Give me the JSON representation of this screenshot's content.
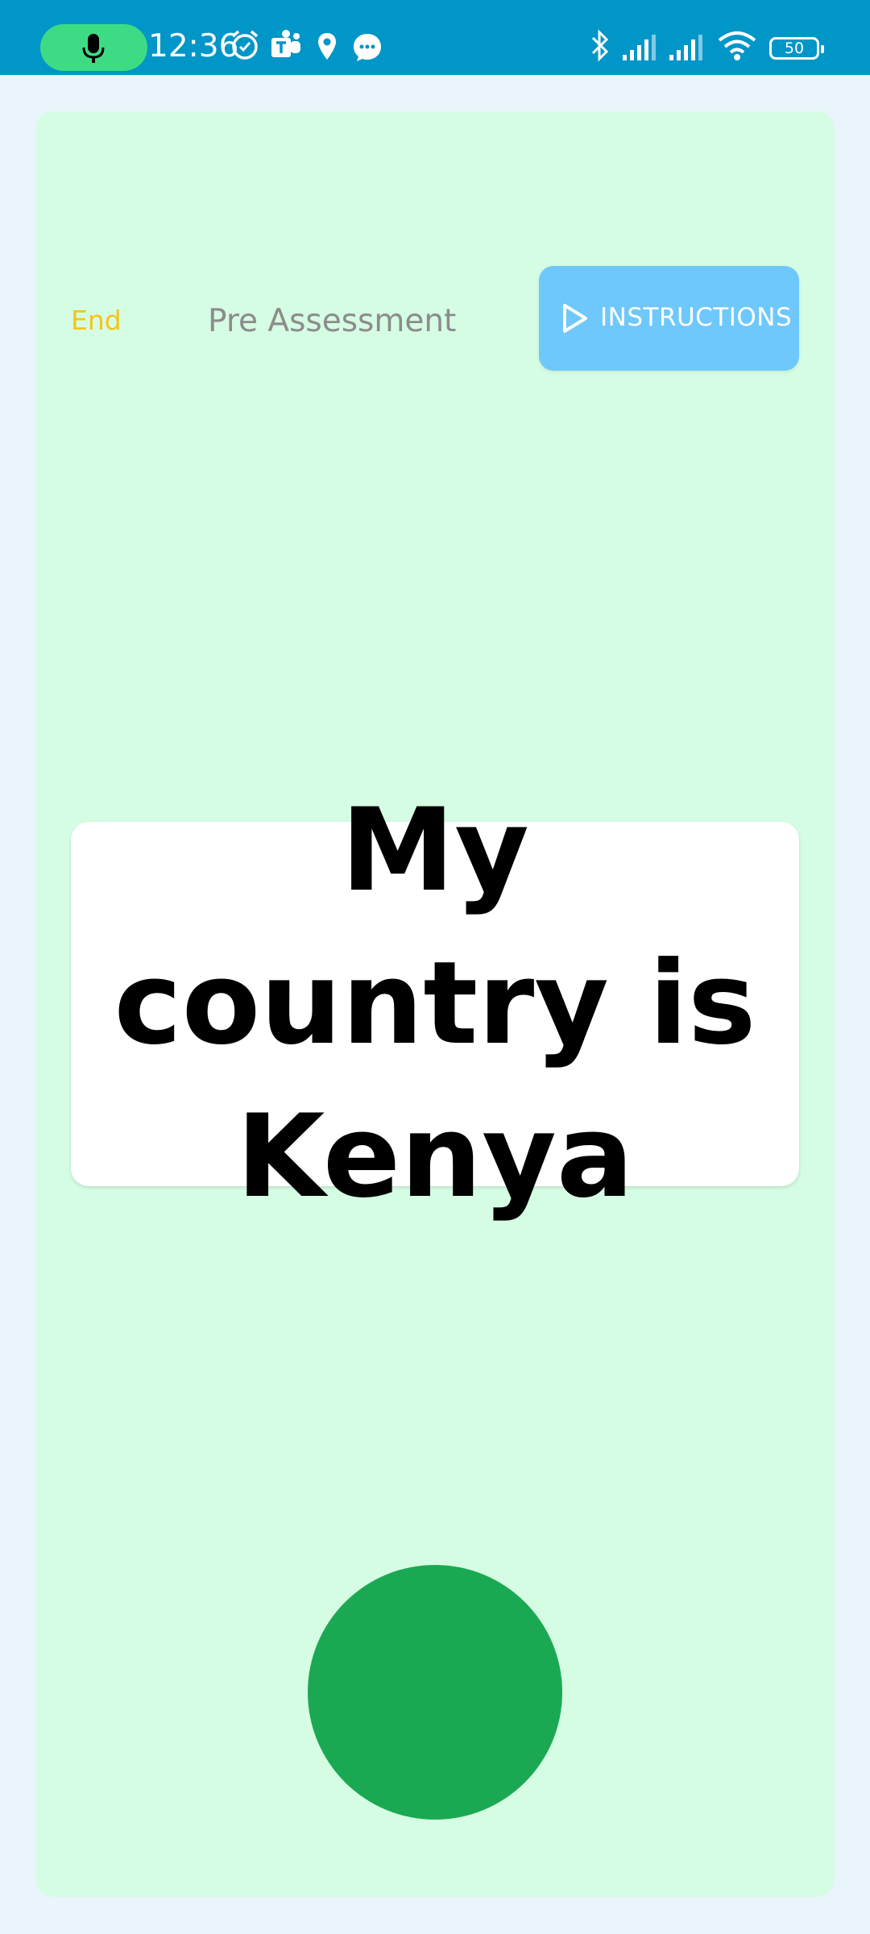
{
  "status_bar": {
    "time": "12:36",
    "battery": "50",
    "icons": [
      "mic-icon",
      "alarm-icon",
      "teams-icon",
      "location-icon",
      "message-icon",
      "bluetooth-icon",
      "signal-icon",
      "signal-icon",
      "wifi-icon",
      "battery-icon"
    ],
    "background_color": "#0096c7",
    "mic_pill_color": "#3ddc84"
  },
  "header": {
    "end_label": "End",
    "title": "Pre Assessment",
    "instructions_label": "INSTRUCTIONS"
  },
  "prompt": {
    "sentence": "My country is Kenya"
  },
  "record_button": {
    "icon": "record-button",
    "color": "#1aa952"
  },
  "colors": {
    "card_background": "#d5fde3",
    "end_link": "#f5c518",
    "instructions_button": "#6ec8fb"
  }
}
